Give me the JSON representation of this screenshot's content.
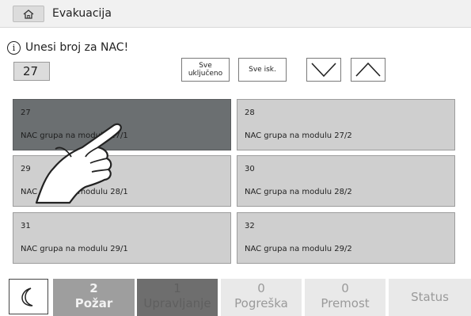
{
  "header": {
    "title": "Evakuacija",
    "home_icon": "home-icon"
  },
  "instruction": {
    "icon": "info-icon",
    "text": "Unesi broj za NAC!"
  },
  "number_input": {
    "value": "27"
  },
  "toolbar": {
    "all_on_label": "Sve uključeno",
    "all_off_label": "Sve isk.",
    "scroll_down_icon": "chevron-down-icon",
    "scroll_up_icon": "chevron-up-icon"
  },
  "nac_tiles": [
    {
      "number": "27",
      "label": "NAC grupa na modulu 27/1",
      "selected": true
    },
    {
      "number": "28",
      "label": "NAC grupa na modulu 27/2",
      "selected": false
    },
    {
      "number": "29",
      "label": "NAC grupa na modulu 28/1",
      "selected": false
    },
    {
      "number": "30",
      "label": "NAC grupa na modulu 28/2",
      "selected": false
    },
    {
      "number": "31",
      "label": "NAC grupa na modulu 29/1",
      "selected": false
    },
    {
      "number": "32",
      "label": "NAC grupa na modulu 29/2",
      "selected": false
    }
  ],
  "bottom_bar": {
    "night_mode_icon": "moon-icon",
    "fire": {
      "count": "2",
      "label": "Požar"
    },
    "control": {
      "count": "1",
      "label": "Upravljanje"
    },
    "fault": {
      "count": "0",
      "label": "Pogreška"
    },
    "bypass": {
      "count": "0",
      "label": "Premost"
    },
    "status": {
      "label": "Status"
    }
  },
  "colors": {
    "selected_tile": "#6b6f71",
    "tile": "#cfcfcf",
    "fire_tab": "#9e9e9e",
    "control_tab": "#6e6e6e"
  }
}
